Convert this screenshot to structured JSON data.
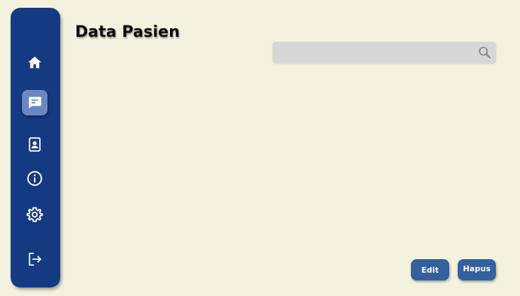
{
  "header": {
    "title": "Data Pasien"
  },
  "search": {
    "placeholder": "",
    "value": ""
  },
  "actions": {
    "edit_label": "Edit",
    "delete_label": "Hapus"
  },
  "sidebar": {
    "items": [
      {
        "icon": "home-icon",
        "active": false
      },
      {
        "icon": "chat-icon",
        "active": true
      },
      {
        "icon": "contact-card-icon",
        "active": false
      },
      {
        "icon": "info-icon",
        "active": false
      },
      {
        "icon": "gear-icon",
        "active": false
      },
      {
        "icon": "logout-icon",
        "active": false
      }
    ]
  },
  "colors": {
    "background": "#f3f2df",
    "sidebar": "#143a82",
    "sidebar_active": "#6b86c2",
    "button": "#34609e",
    "search_bg": "#d7d7d7"
  }
}
